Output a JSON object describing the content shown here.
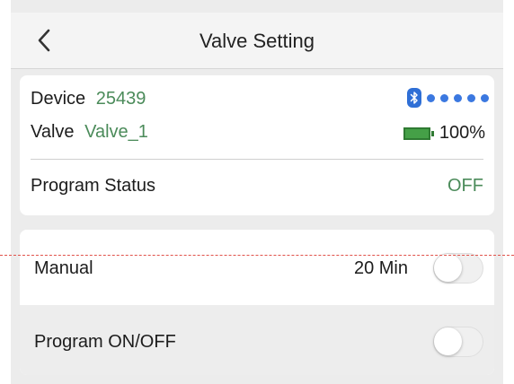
{
  "header": {
    "title": "Valve Setting",
    "back_icon": "chevron-left-icon"
  },
  "device_info": {
    "device_label": "Device",
    "device_id": "25439",
    "valve_label": "Valve",
    "valve_name": "Valve_1",
    "bluetooth_icon": "bluetooth-icon",
    "signal_strength_dots": 5,
    "battery_icon": "battery-icon",
    "battery_percent": "100%",
    "program_status_label": "Program Status",
    "program_status_value": "OFF"
  },
  "controls": {
    "manual_label": "Manual",
    "manual_duration": "20 Min",
    "manual_toggle_on": false,
    "program_label": "Program ON/OFF",
    "program_toggle_on": false
  },
  "colors": {
    "accent_green": "#4b8b5a",
    "bluetooth_blue": "#2f6fd6",
    "battery_green": "#45a047",
    "dashed_line": "#e0524a"
  }
}
